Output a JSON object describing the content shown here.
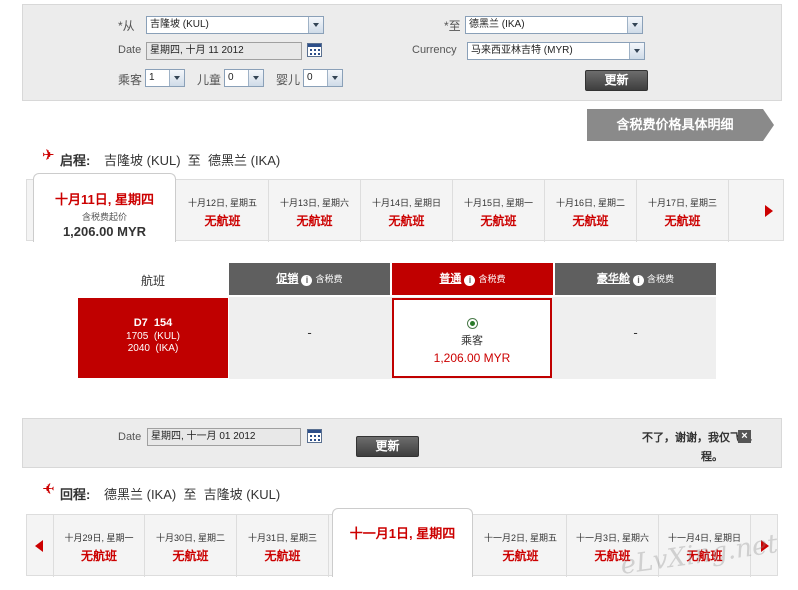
{
  "search": {
    "from_label": "*从",
    "from_value": "吉隆坡 (KUL)",
    "to_label": "*至",
    "to_value": "德黑兰 (IKA)",
    "date_label": "Date",
    "date_value": "星期四, 十月 11 2012",
    "currency_label": "Currency",
    "currency_value": "马来西亚林吉特 (MYR)",
    "adult_label": "乘客",
    "adult_value": "1",
    "child_label": "儿童",
    "child_value": "0",
    "infant_label": "婴儿",
    "infant_value": "0",
    "update_label": "更新"
  },
  "tax_detail_label": "含税费价格具体明细",
  "outbound": {
    "prefix": "启程:",
    "route": "吉隆坡 (KUL)  至  德黑兰 (IKA)",
    "selected_date": "十月11日, 星期四",
    "selected_fare_note": "含税费起价",
    "selected_price": "1,206.00 MYR",
    "dates": [
      {
        "date": "十月12日, 星期五",
        "note": "无航班"
      },
      {
        "date": "十月13日, 星期六",
        "note": "无航班"
      },
      {
        "date": "十月14日, 星期日",
        "note": "无航班"
      },
      {
        "date": "十月15日, 星期一",
        "note": "无航班"
      },
      {
        "date": "十月16日, 星期二",
        "note": "无航班"
      },
      {
        "date": "十月17日, 星期三",
        "note": "无航班"
      }
    ]
  },
  "fares": {
    "flight_header": "航班",
    "columns": [
      {
        "name": "促销",
        "note": "含税费"
      },
      {
        "name": "普通",
        "note": "含税费"
      },
      {
        "name": "豪华舱",
        "note": "含税费"
      }
    ],
    "flight_number": "D7  154",
    "depart": "1705  (KUL)",
    "arrive": "2040  (IKA)",
    "promo_value": "-",
    "regular_pax": "乘客",
    "regular_price": "1,206.00 MYR",
    "premium_value": "-"
  },
  "return_search": {
    "date_label": "Date",
    "date_value": "星期四, 十一月 01 2012",
    "update_label": "更新",
    "oneway_line1": "不了，谢谢，我仅飞单",
    "oneway_line2": "程。",
    "close_glyph": "×"
  },
  "inbound": {
    "prefix": "回程:",
    "route": "德黑兰 (IKA)  至  吉隆坡 (KUL)",
    "selected_date": "十一月1日, 星期四",
    "dates_before": [
      {
        "date": "十月29日, 星期一",
        "note": "无航班"
      },
      {
        "date": "十月30日, 星期二",
        "note": "无航班"
      },
      {
        "date": "十月31日, 星期三",
        "note": "无航班"
      }
    ],
    "dates_after": [
      {
        "date": "十一月2日, 星期五",
        "note": "无航班"
      },
      {
        "date": "十一月3日, 星期六",
        "note": "无航班"
      },
      {
        "date": "十一月4日, 星期日",
        "note": "无航班"
      }
    ]
  },
  "watermark": "eLvXing.net",
  "colors": {
    "brand_red": "#c00000",
    "dark_gray": "#5a5a5a",
    "panel": "#ececec"
  }
}
